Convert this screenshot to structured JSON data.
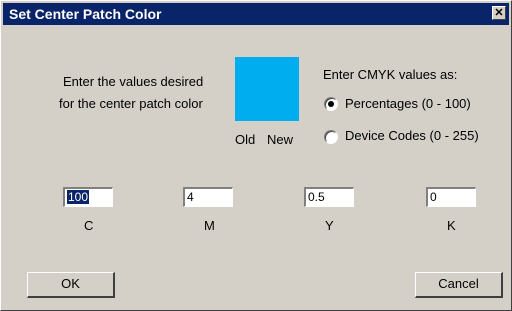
{
  "window": {
    "title": "Set Center Patch Color",
    "close_glyph": "✕"
  },
  "instructions": {
    "line1": "Enter the values desired",
    "line2": "for the center patch color"
  },
  "patch": {
    "color": "#00aeef",
    "old_label": "Old",
    "new_label": "New"
  },
  "cmyk_mode": {
    "heading": "Enter CMYK values as:",
    "options": [
      {
        "label": "Percentages (0 - 100)",
        "selected": true
      },
      {
        "label": "Device Codes (0 - 255)",
        "selected": false
      }
    ]
  },
  "fields": [
    {
      "value": "100",
      "label": "C"
    },
    {
      "value": "4",
      "label": "M"
    },
    {
      "value": "0.5",
      "label": "Y"
    },
    {
      "value": "0",
      "label": "K"
    }
  ],
  "buttons": {
    "ok": "OK",
    "cancel": "Cancel"
  },
  "colors": {
    "title_bar": "#0a246a",
    "dialog_bg": "#d4d0c8"
  }
}
